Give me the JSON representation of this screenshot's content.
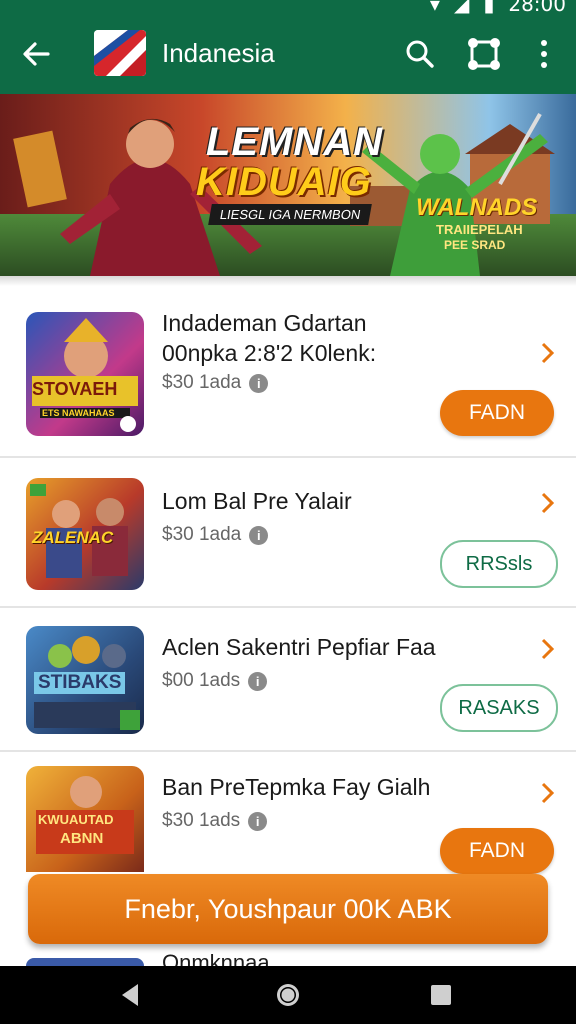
{
  "status_bar": {
    "time": "28:00"
  },
  "app_bar": {
    "title": "Indanesia"
  },
  "banner": {
    "title_line1": "LEMNAN",
    "title_line2": "KIDUAIG",
    "subtitle": "LIESGL IGA NERMBON",
    "right_title": "WALNADS",
    "right_sub1": "TRAIIEPELAH",
    "right_sub2": "PEE SRAD"
  },
  "games": [
    {
      "title_line1": "Indademan Gdartan",
      "title_line2": "00npka 2:8'2 K0lenk:",
      "price": "$30 1ada",
      "thumb_text": "STOVAEH",
      "thumb_sub": "ETS NAWAHAAS",
      "action": "FADN",
      "action_style": "filled"
    },
    {
      "title_line1": "Lom Bal Pre Yalair",
      "title_line2": "",
      "price": "$30 1ada",
      "thumb_text": "ZALENAC",
      "thumb_sub": "",
      "action": "RRSsls",
      "action_style": "outline"
    },
    {
      "title_line1": "Aclen Sakentri Pepfiar Faa",
      "title_line2": "",
      "price": "$00 1ads",
      "thumb_text": "STIBAKS",
      "thumb_sub": "",
      "action": "RASAKS",
      "action_style": "outline"
    },
    {
      "title_line1": "Ban PreTepmka Fay Gialh",
      "title_line2": "",
      "price": "$30 1ads",
      "thumb_text": "KWUAUTAD",
      "thumb_sub": "ABNN",
      "action": "FADN",
      "action_style": "filled"
    }
  ],
  "cta_button": "Fnebr, Youshpaur 00K ABK",
  "peek_item_title": "Onmknnaa",
  "colors": {
    "primary": "#0e6b45",
    "accent": "#e8760f",
    "outline": "#7cc29a"
  },
  "icons": [
    "back-arrow-icon",
    "search-icon",
    "share-icon",
    "more-vert-icon",
    "info-icon",
    "chevron-right-icon",
    "nav-back-icon",
    "nav-home-icon",
    "nav-recents-icon"
  ]
}
